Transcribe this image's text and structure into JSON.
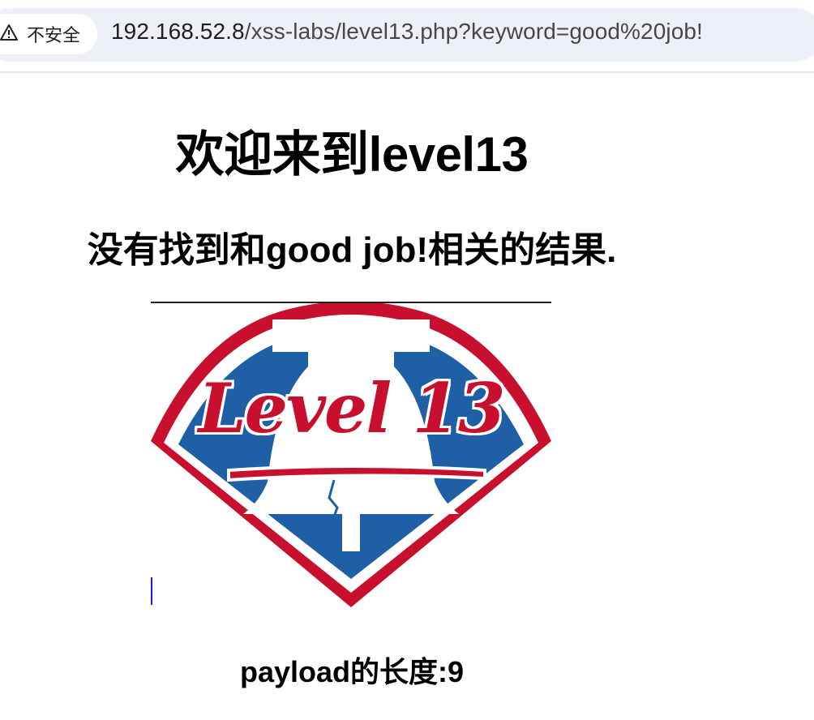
{
  "browser": {
    "security_label": "不安全",
    "url_host": "192.168.52.8",
    "url_path": "/xss-labs/level13.php?keyword=good%20job!"
  },
  "page": {
    "title": "欢迎来到level13",
    "result_text": "没有找到和good job!相关的结果.",
    "logo": {
      "alt_text": "Level 13",
      "colors": {
        "red": "#c8102e",
        "blue": "#1f5fa6",
        "white": "#ffffff"
      }
    },
    "payload_text": "payload的长度:9"
  },
  "icons": {
    "security": "warning-triangle-icon"
  }
}
